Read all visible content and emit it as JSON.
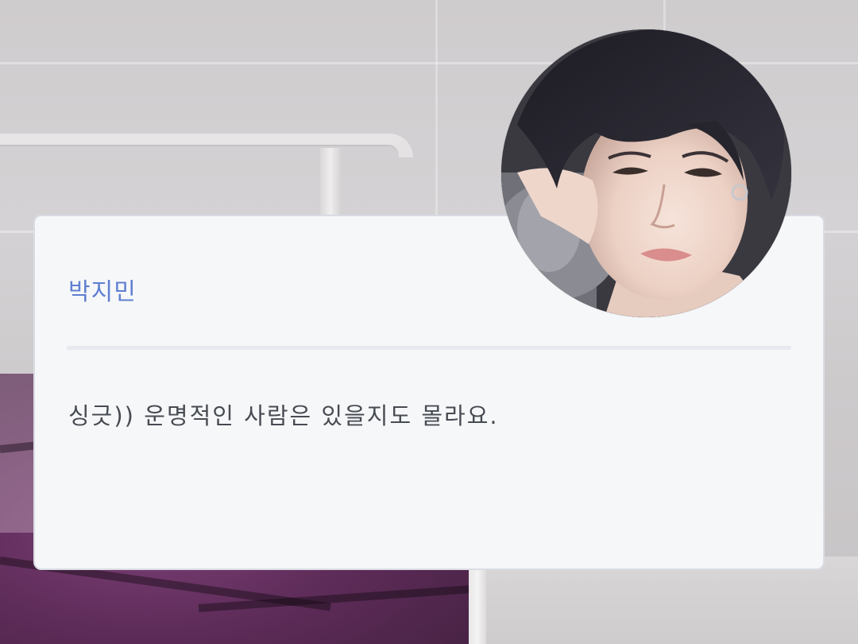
{
  "character": {
    "name": "박지민",
    "dialogue": "싱긋)) 운명적인 사람은 있을지도 몰라요.",
    "avatar_icon": "character-portrait",
    "name_color": "#5f7fd0"
  }
}
